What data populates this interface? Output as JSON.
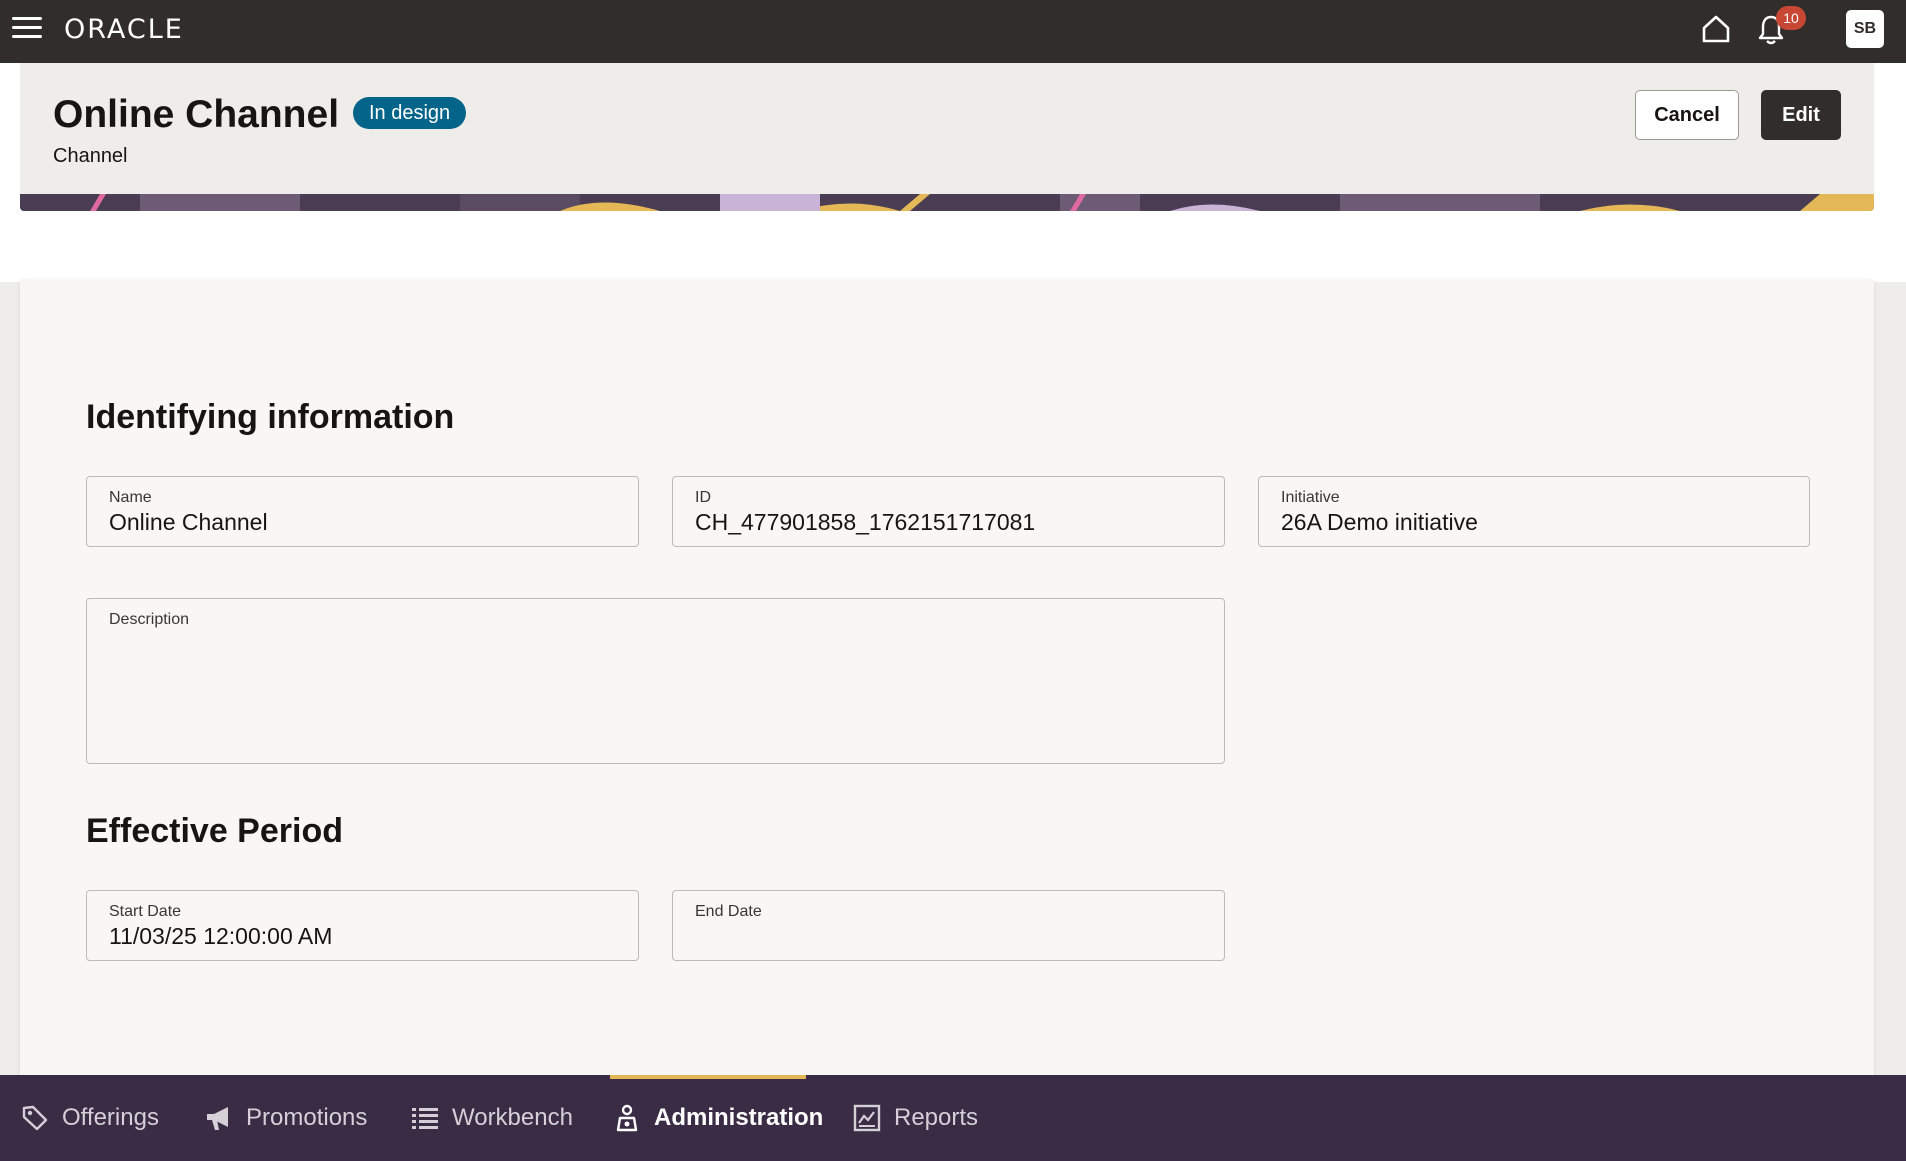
{
  "topbar": {
    "logo": "ORACLE",
    "notification_count": "10",
    "avatar_initials": "SB"
  },
  "header": {
    "title": "Online Channel",
    "status": "In design",
    "subtitle": "Channel",
    "cancel_label": "Cancel",
    "edit_label": "Edit"
  },
  "identifying": {
    "section_title": "Identifying information",
    "name_label": "Name",
    "name_value": "Online Channel",
    "id_label": "ID",
    "id_value": "CH_477901858_1762151717081",
    "initiative_label": "Initiative",
    "initiative_value": "26A Demo initiative",
    "description_label": "Description",
    "description_value": ""
  },
  "effective": {
    "section_title": "Effective Period",
    "start_label": "Start Date",
    "start_value": "11/03/25 12:00:00 AM",
    "end_label": "End Date",
    "end_value": ""
  },
  "bottomnav": {
    "items": [
      {
        "label": "Offerings",
        "icon": "tag-icon",
        "active": false
      },
      {
        "label": "Promotions",
        "icon": "megaphone-icon",
        "active": false
      },
      {
        "label": "Workbench",
        "icon": "list-icon",
        "active": false
      },
      {
        "label": "Administration",
        "icon": "admin-icon",
        "active": true
      },
      {
        "label": "Reports",
        "icon": "report-chart-icon",
        "active": false
      }
    ]
  },
  "colors": {
    "topbar": "#312d2a",
    "status_badge": "#04648a",
    "bottom_nav": "#3a2c45",
    "active_indicator": "#e5b857",
    "notification_badge": "#c74634"
  }
}
